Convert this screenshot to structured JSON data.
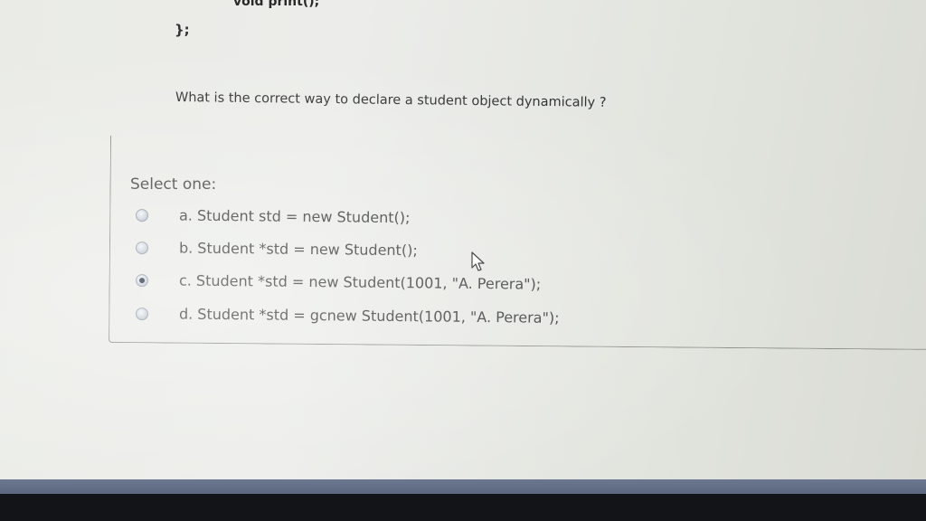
{
  "code": {
    "top_line": "void print();",
    "closing_brace": "};"
  },
  "question": {
    "text": "What is the correct way to declare a student object dynamically ?"
  },
  "answer": {
    "prompt": "Select one:",
    "selected_index": 2,
    "options": [
      {
        "label": "a. Student std = new Student();"
      },
      {
        "label": "b. Student *std = new Student();"
      },
      {
        "label": "c. Student *std = new Student(1001, \"A. Perera\");"
      },
      {
        "label": "d. Student *std = gcnew Student(1001, \"A. Perera\");"
      }
    ]
  },
  "icons": {
    "cursor": "mouse-pointer-icon"
  }
}
